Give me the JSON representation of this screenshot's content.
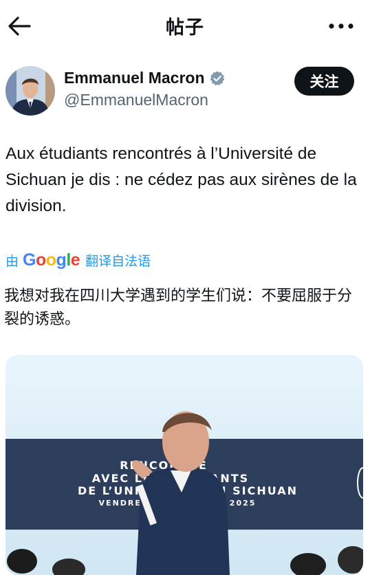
{
  "header": {
    "title": "帖子"
  },
  "author": {
    "name": "Emmanuel Macron",
    "handle": "@EmmanuelMacron",
    "follow_label": "关注"
  },
  "tweet": {
    "text": "Aux étudiants rencontrés à l’Université de Sichuan je dis : ne cédez pas aux sirènes de la division."
  },
  "translation": {
    "by_label": "由",
    "provider": "Google",
    "action_label": "翻译自法语",
    "text": "我想对我在四川大学遇到的学生们说：不要屈服于分裂的诱惑。"
  },
  "media": {
    "banner_lines": [
      "RENCONTRE",
      "AVEC LES ÉTUDIANTS",
      "DE L’UNIVERSITÉ DU SICHUAN",
      "VENDREDI 5 DÉCEMBRE 2025"
    ]
  },
  "colors": {
    "link_blue": "#1d9bf0",
    "text_primary": "#0f1419",
    "text_secondary": "#536471",
    "verified_badge": "#829aab",
    "banner_navy": "#2c3e5c"
  }
}
